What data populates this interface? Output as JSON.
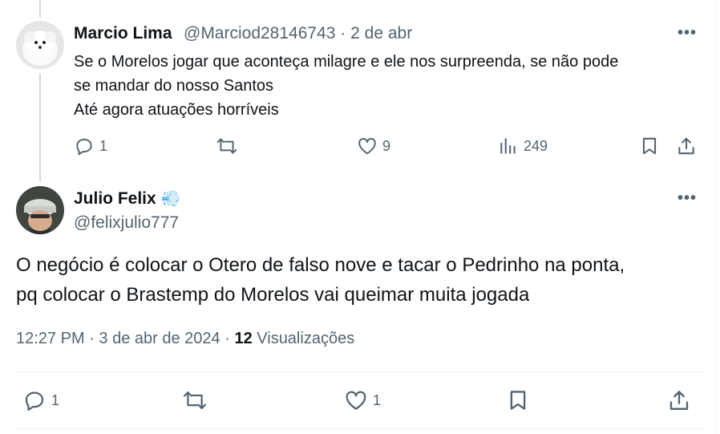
{
  "tweet1": {
    "author_name": "Marcio Lima",
    "author_handle": "@Marciod28146743",
    "separator": "·",
    "date": "2 de abr",
    "text_lines": [
      "Se o Morelos jogar que aconteça milagre e ele nos surpreenda, se não pode",
      "se mandar do nosso Santos",
      "Até agora atuações horríveis"
    ],
    "actions": {
      "replies": "1",
      "reposts": "",
      "likes": "9",
      "views": "249"
    }
  },
  "tweet2": {
    "author_name": "Julio Felix",
    "author_badge_emoji": "💨",
    "author_handle": "@felixjulio777",
    "text_lines": [
      "O negócio é colocar o Otero de falso nove e tacar o Pedrinho na ponta,",
      "pq colocar o Brastemp do Morelos vai queimar muita jogada"
    ],
    "time": "12:27 PM",
    "separator": "·",
    "date": "3 de abr de 2024",
    "views_count": "12",
    "views_label": "Visualizações",
    "actions": {
      "replies": "1",
      "reposts": "",
      "likes": "1"
    }
  },
  "icons": [
    "more-icon",
    "reply-icon",
    "repost-icon",
    "like-icon",
    "views-icon",
    "bookmark-icon",
    "share-icon"
  ],
  "colors": {
    "text": "#0f1419",
    "secondary": "#536471",
    "divider": "#eff3f4",
    "thread_line": "#cfd9de"
  }
}
